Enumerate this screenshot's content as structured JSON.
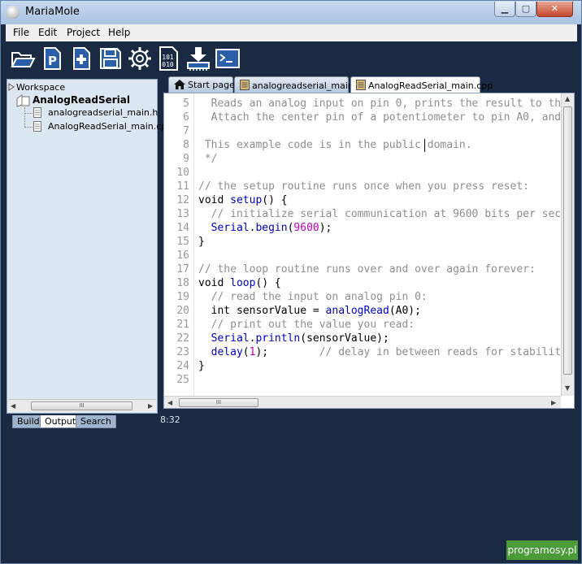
{
  "window": {
    "title": "MariaMole"
  },
  "title_buttons": {
    "minimize": "▁",
    "maximize": "▢",
    "close": "✕"
  },
  "menu": [
    "File",
    "Edit",
    "Project",
    "Help"
  ],
  "toolbar": {
    "buttons": [
      "open-folder-icon",
      "open-project-icon",
      "new-file-icon",
      "save-icon",
      "settings-gear-icon",
      "compile-binary-icon",
      "upload-download-icon",
      "serial-terminal-icon"
    ]
  },
  "sidebar": {
    "root": "Workspace",
    "project": "AnalogReadSerial",
    "files": [
      "analogreadserial_main.h",
      "AnalogReadSerial_main.cpp"
    ],
    "scroll_grip": "III"
  },
  "bottom_tabs": [
    "Build",
    "Output",
    "Search"
  ],
  "editor_tabs": [
    "Start page",
    "analogreadserial_main.h",
    "AnalogReadSerial_main.cpp"
  ],
  "editor": {
    "line_numbers": [
      "5",
      "6",
      "7",
      "8",
      "9",
      "10",
      "11",
      "12",
      "13",
      "14",
      "15",
      "16",
      "17",
      "18",
      "19",
      "20",
      "21",
      "22",
      "23",
      "24",
      "25"
    ],
    "scroll_grip": "III"
  },
  "status": {
    "cursor": "8:32"
  },
  "watermark": "programosy.pl",
  "colors": {
    "background": "#1b2a43",
    "keyword_fn": "#0000c8",
    "comment": "#8f8f8f",
    "number": "#c000c0"
  }
}
